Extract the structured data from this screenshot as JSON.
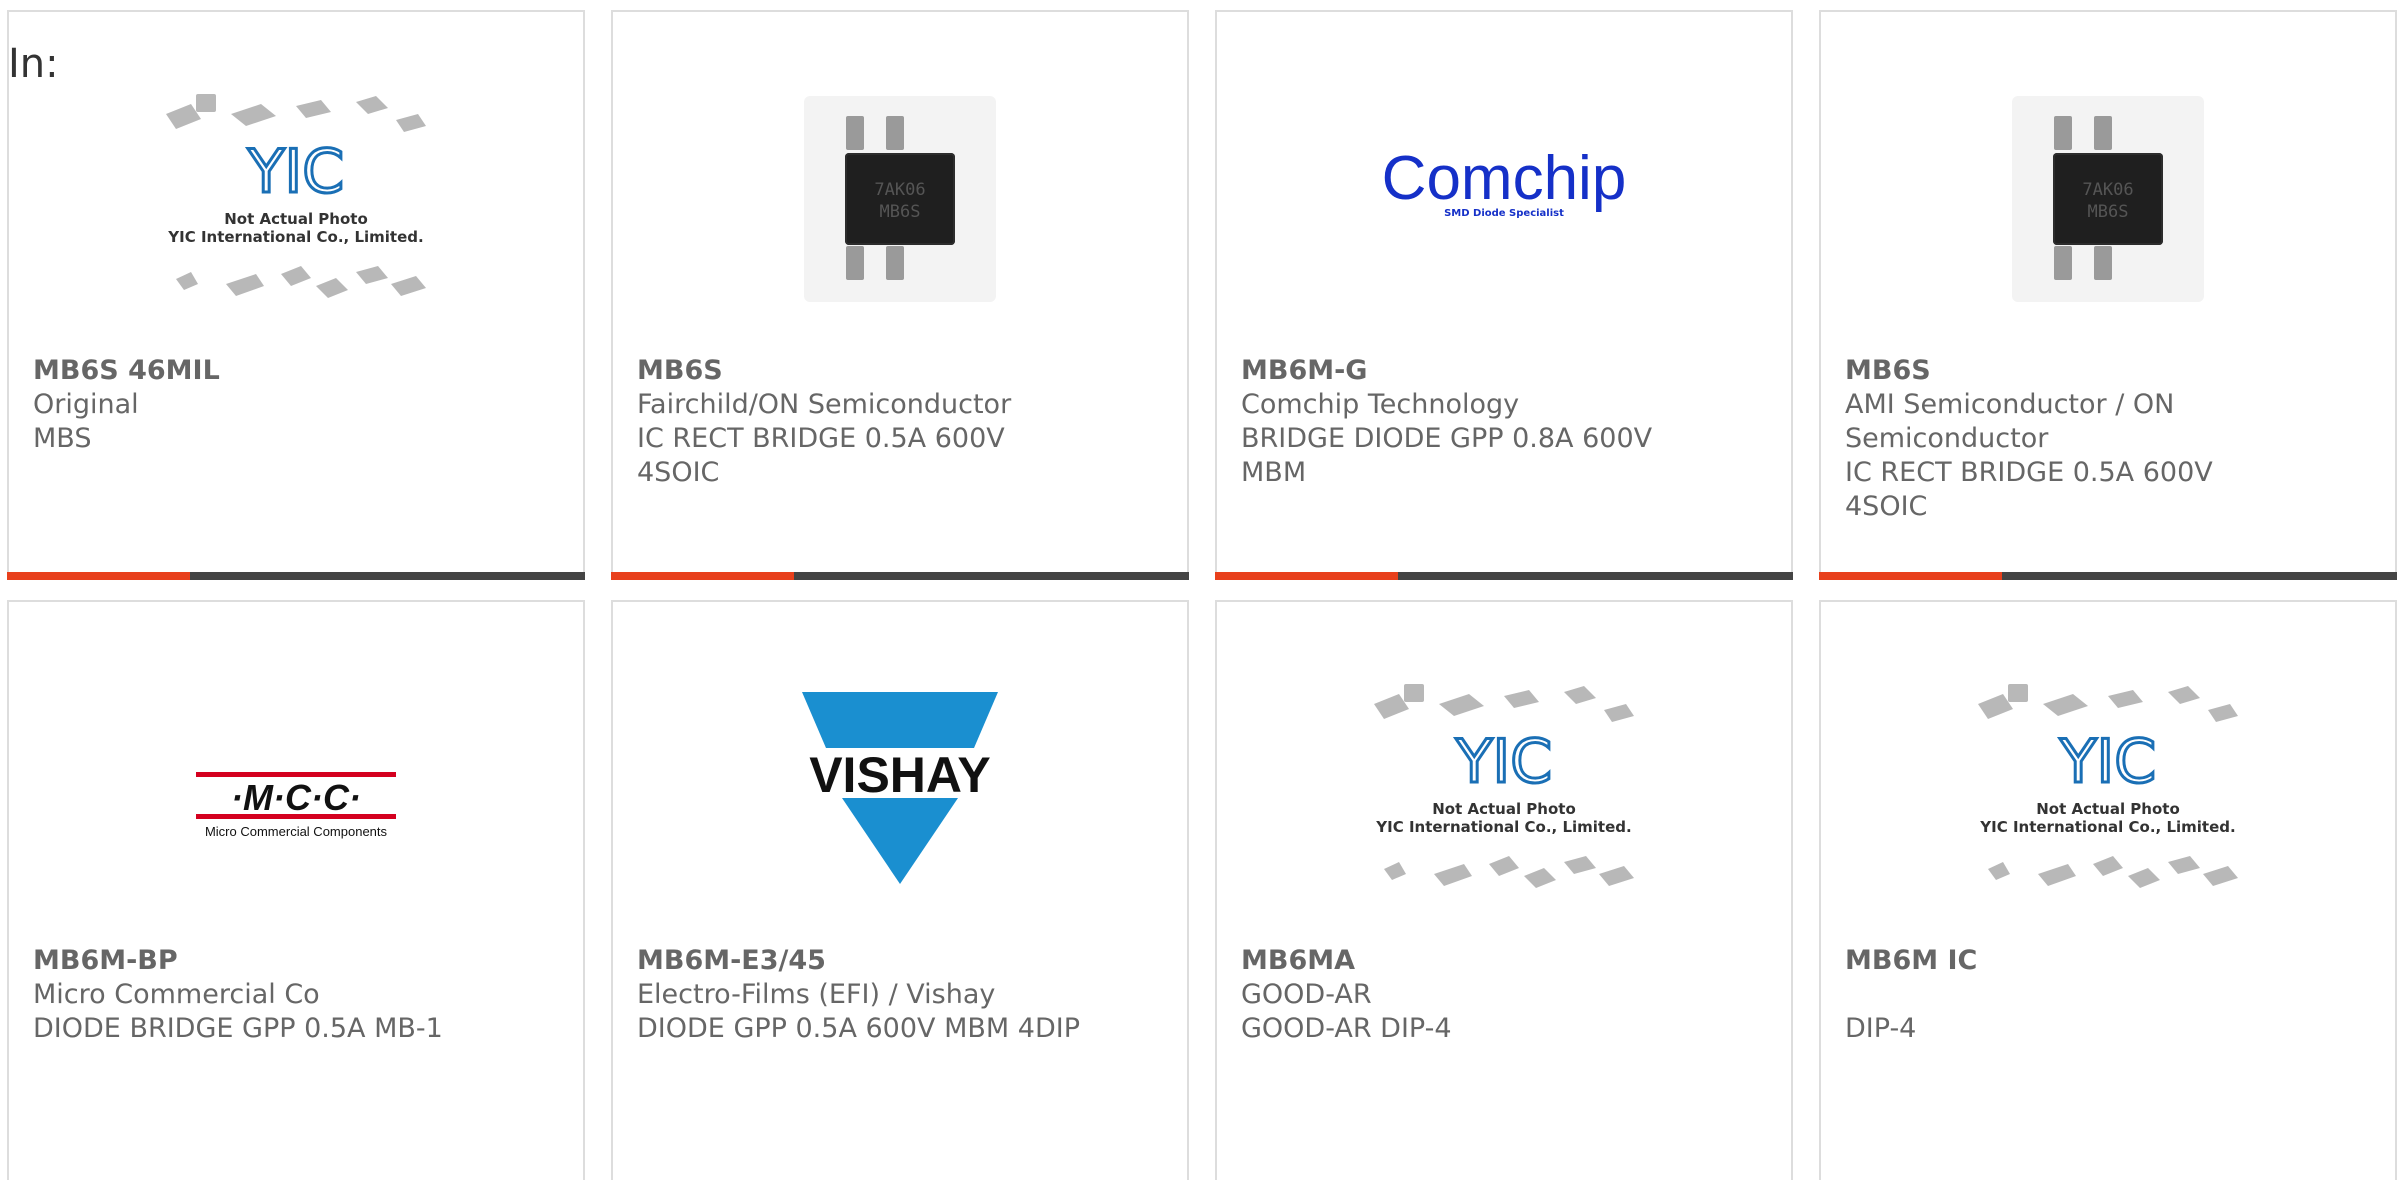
{
  "header": {
    "in_label": "In:"
  },
  "colors": {
    "accent_bar": "#e8401c",
    "bar_dark": "#444444",
    "text": "#666666",
    "border": "#dddddd"
  },
  "products": [
    {
      "part_number": "MB6S 46MIL",
      "lines": [
        "Original",
        "MBS"
      ],
      "image": {
        "type": "placeholder",
        "caption_1": "Not Actual Photo",
        "caption_2": "YIC International Co., Limited.",
        "logo": "YIC"
      }
    },
    {
      "part_number": "MB6S",
      "lines": [
        "Fairchild/ON Semiconductor",
        "IC RECT BRIDGE 0.5A 600V",
        "4SOIC"
      ],
      "image": {
        "type": "chip",
        "marking_1": "7AK06",
        "marking_2": "MB6S"
      }
    },
    {
      "part_number": "MB6M-G",
      "lines": [
        "Comchip Technology",
        "BRIDGE DIODE GPP 0.8A 600V",
        "MBM"
      ],
      "image": {
        "type": "logo-comchip",
        "logo_text": "Comchip",
        "tagline": "SMD Diode Specialist"
      }
    },
    {
      "part_number": "MB6S",
      "lines": [
        "AMI Semiconductor / ON",
        "Semiconductor",
        "IC RECT BRIDGE 0.5A 600V",
        "4SOIC"
      ],
      "image": {
        "type": "chip",
        "marking_1": "7AK06",
        "marking_2": "MB6S"
      }
    },
    {
      "part_number": "MB6M-BP",
      "lines": [
        "Micro Commercial Co",
        "DIODE BRIDGE GPP 0.5A MB-1"
      ],
      "image": {
        "type": "logo-mcc",
        "logo_text": "·M·C·C·",
        "tagline": "Micro Commercial Components"
      }
    },
    {
      "part_number": "MB6M-E3/45",
      "lines": [
        "Electro-Films (EFI) / Vishay",
        "DIODE GPP 0.5A 600V MBM 4DIP"
      ],
      "image": {
        "type": "logo-vishay",
        "logo_text": "VISHAY"
      }
    },
    {
      "part_number": "MB6MA",
      "lines": [
        "GOOD-AR",
        "GOOD-AR DIP-4"
      ],
      "image": {
        "type": "placeholder",
        "caption_1": "Not Actual Photo",
        "caption_2": "YIC International Co., Limited.",
        "logo": "YIC"
      }
    },
    {
      "part_number": "MB6M IC",
      "lines": [
        "",
        "DIP-4"
      ],
      "image": {
        "type": "placeholder",
        "caption_1": "Not Actual Photo",
        "caption_2": "YIC International Co., Limited.",
        "logo": "YIC"
      }
    }
  ]
}
